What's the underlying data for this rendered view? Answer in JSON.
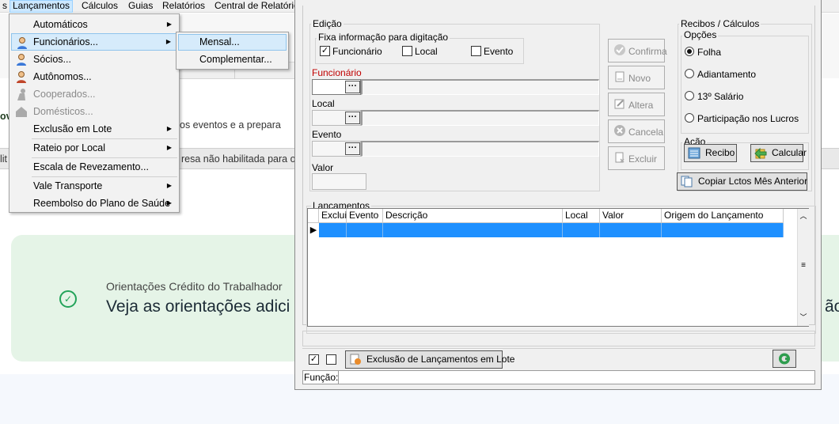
{
  "menubar": {
    "items": [
      "s",
      "Lançamentos",
      "Cálculos",
      "Guias",
      "Relatórios",
      "Central de Relatórios"
    ]
  },
  "menu": {
    "items": [
      {
        "label": "Automáticos"
      },
      {
        "label": "Funcionários..."
      },
      {
        "label": "Sócios..."
      },
      {
        "label": "Autônomos..."
      },
      {
        "label": "Cooperados..."
      },
      {
        "label": "Domésticos..."
      },
      {
        "label": "Exclusão em Lote"
      },
      {
        "label": "Rateio por Local"
      },
      {
        "label": "Escala de Revezamento..."
      },
      {
        "label": "Vale Transporte"
      },
      {
        "label": "Reembolso do Plano de Saúde"
      }
    ],
    "submenu": [
      "Mensal...",
      "Complementar..."
    ]
  },
  "background": {
    "left_fragment_1": "ov",
    "text_1": "os eventos e a prepara",
    "status_left": "lit",
    "status_text": "resa não habilitada para o",
    "callout_title": "Orientações Crédito do Trabalhador",
    "callout_text": "Veja as orientações adici",
    "callout_right": "ão"
  },
  "dialog": {
    "edicao": {
      "title": "Edição",
      "fixa_title": "Fixa informação para digitação",
      "chk_funcionario": {
        "label": "Funcionário",
        "checked": true
      },
      "chk_local": {
        "label": "Local",
        "checked": false
      },
      "chk_evento": {
        "label": "Evento",
        "checked": false
      },
      "funcionario_label": "Funcionário",
      "local_label": "Local",
      "evento_label": "Evento",
      "valor_label": "Valor",
      "ellipsis": "···"
    },
    "buttons": {
      "confirma": "Confirma",
      "novo": "Novo",
      "altera": "Altera",
      "cancela": "Cancela",
      "excluir": "Excluir"
    },
    "recibos": {
      "title": "Recibos / Cálculos",
      "opcoes_title": "Opções",
      "options": [
        "Folha",
        "Adiantamento",
        "13º Salário",
        "Participação nos Lucros"
      ],
      "selected": "Folha",
      "acao_title": "Ação",
      "recibo": "Recibo",
      "calcular": "Calcular",
      "copiar": "Copiar Lctos Mês Anterior"
    },
    "lancamentos": {
      "title": "Lançamentos",
      "columns": [
        "Excluir",
        "Evento",
        "Descrição",
        "Local",
        "Valor",
        "Origem do Lançamento"
      ]
    },
    "bottom": {
      "exclusao_lote": "Exclusão de Lançamentos em Lote",
      "funcao_label": "Função:"
    },
    "colors": {
      "accent_red": "#c00000",
      "selection_blue": "#1e90ff"
    }
  }
}
